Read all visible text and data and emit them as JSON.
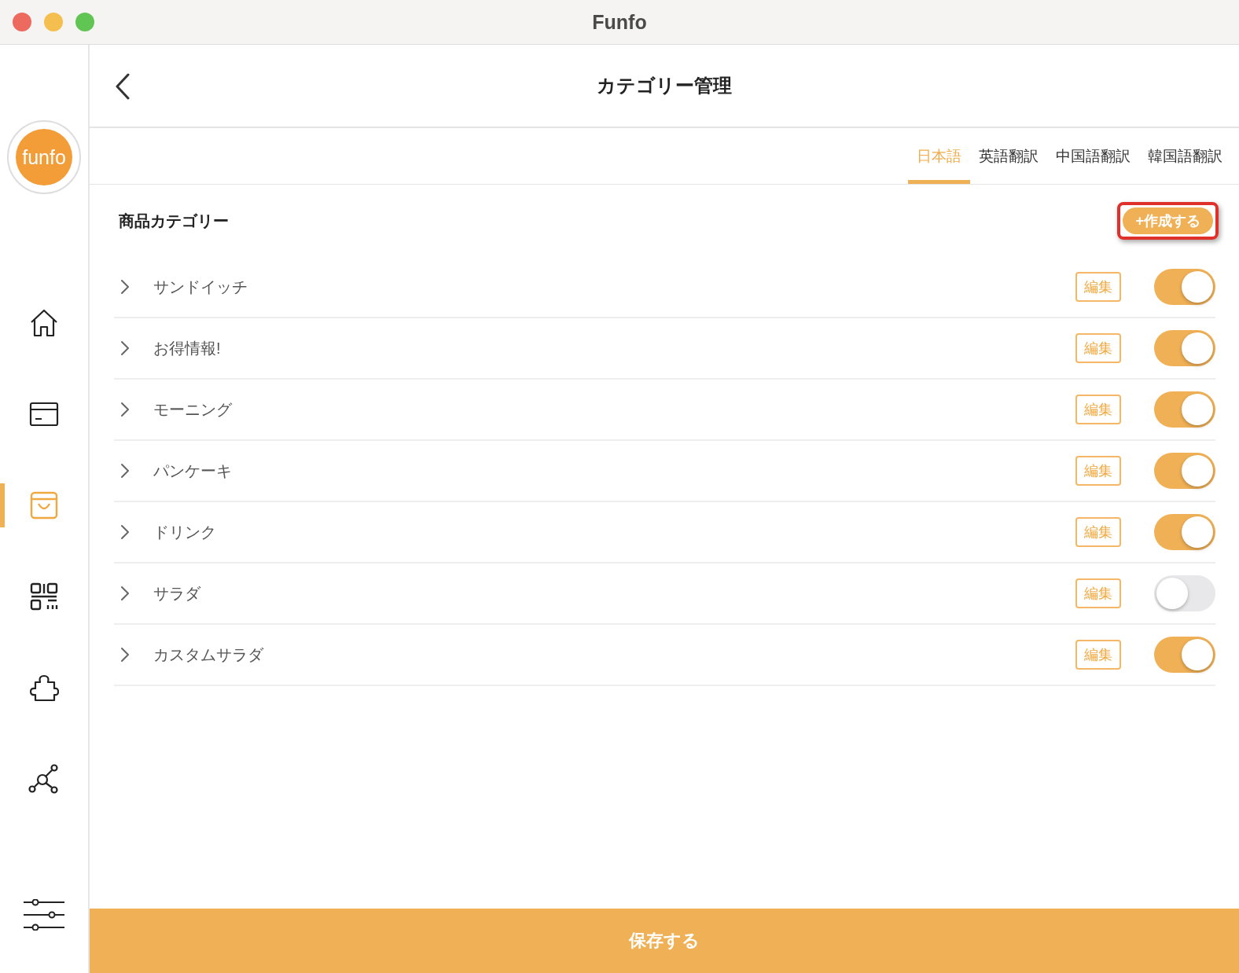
{
  "window": {
    "title": "Funfo"
  },
  "logo": {
    "text": "funfo"
  },
  "sidebar": {
    "items": [
      {
        "kind": "home",
        "selected": false
      },
      {
        "kind": "card",
        "selected": false
      },
      {
        "kind": "bag",
        "selected": true
      },
      {
        "kind": "qr",
        "selected": false
      },
      {
        "kind": "puzzle",
        "selected": false
      },
      {
        "kind": "network",
        "selected": false
      }
    ],
    "bottom_item": {
      "kind": "sliders",
      "selected": false
    }
  },
  "header": {
    "title": "カテゴリー管理"
  },
  "tabs": [
    {
      "label": "日本語",
      "selected": true
    },
    {
      "label": "英語翻訳",
      "selected": false
    },
    {
      "label": "中国語翻訳",
      "selected": false
    },
    {
      "label": "韓国語翻訳",
      "selected": false
    }
  ],
  "section": {
    "title": "商品カテゴリー",
    "create_button": {
      "label": "+作成する",
      "highlighted": true
    }
  },
  "categories": [
    {
      "name": "サンドイッチ",
      "edit": "編集",
      "on": true
    },
    {
      "name": "お得情報!",
      "edit": "編集",
      "on": true
    },
    {
      "name": "モーニング",
      "edit": "編集",
      "on": true
    },
    {
      "name": "パンケーキ",
      "edit": "編集",
      "on": true
    },
    {
      "name": "ドリンク",
      "edit": "編集",
      "on": true
    },
    {
      "name": "サラダ",
      "edit": "編集",
      "on": false
    },
    {
      "name": "カスタムサラダ",
      "edit": "編集",
      "on": true
    }
  ],
  "save_button": {
    "label": "保存する"
  }
}
